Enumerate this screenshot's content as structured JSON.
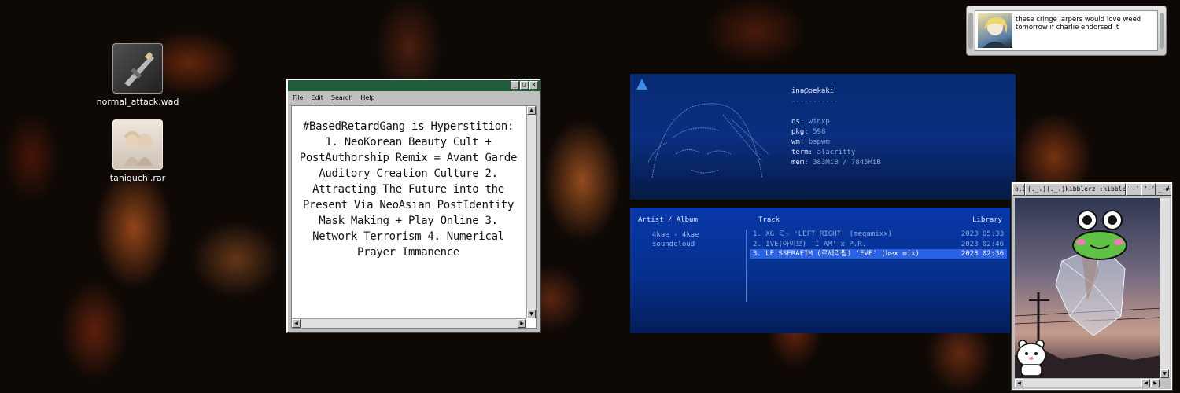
{
  "desktop": {
    "icons": [
      {
        "label": "normal_attack.wad"
      },
      {
        "label": "taniguchi.rar"
      }
    ]
  },
  "notepad": {
    "menu": [
      "File",
      "Edit",
      "Search",
      "Help"
    ],
    "text": "#BasedRetardGang is Hyperstition:  1. NeoKorean Beauty Cult + PostAuthorship Remix = Avant Garde Auditory Creation Culture 2. Attracting The Future into the Present Via NeoAsian PostIdentity Mask Making + Play Online  3. Network Terrorism   4. Numerical Prayer Immanence"
  },
  "neofetch": {
    "user_host": "ina@oekaki",
    "separator": "-----------",
    "rows": [
      {
        "key": "os:",
        "value": "winxp"
      },
      {
        "key": "pkg:",
        "value": "598"
      },
      {
        "key": "wm:",
        "value": "bspwm"
      },
      {
        "key": "term:",
        "value": "alacritty"
      },
      {
        "key": "mem:",
        "value": "383MiB / 7845MiB"
      }
    ]
  },
  "player": {
    "headers": {
      "artist": "Artist / Album",
      "track": "Track",
      "library": "Library"
    },
    "artists": [
      "4kae - 4kae",
      "soundcloud"
    ],
    "tracks": [
      {
        "title": "1. XG ミ☆ 'LEFT RIGHT' (megamixx)",
        "meta": "2023 05:33"
      },
      {
        "title": "2. IVE(아이브) 'I AM' x P.R.",
        "meta": "2023 02:46"
      },
      {
        "title": "3. LE SSERAFIM (르세라핌) 'EVE' (hex mix)",
        "meta": "2023 02:36"
      }
    ],
    "selected_index": 2
  },
  "notification": {
    "message": "these cringe larpers would love weed tomorrow if charlie endorsed it"
  },
  "viewer": {
    "title_segments": [
      "o.0",
      "(._.)(._.)kibblerz :kibble:",
      "'-'",
      "'-'.",
      "_-#"
    ]
  }
}
